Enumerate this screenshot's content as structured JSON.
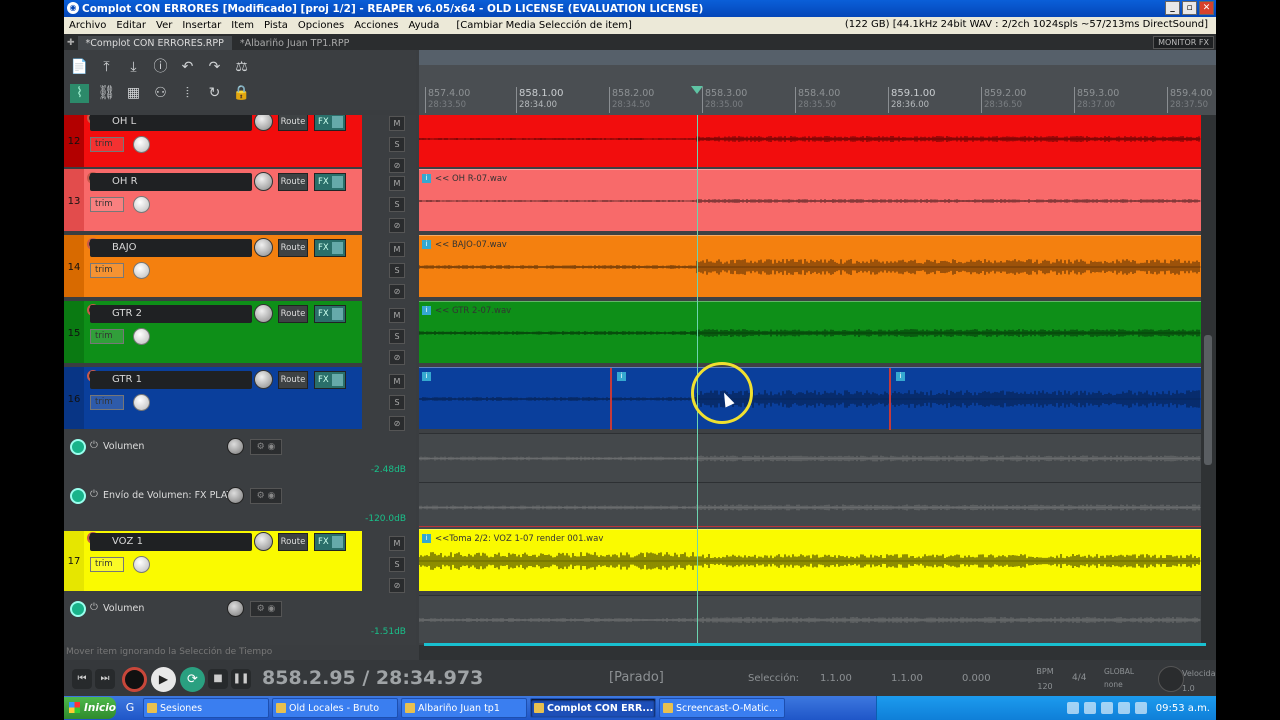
{
  "window": {
    "title": "Complot CON ERRORES [Modificado] [proj 1/2] - REAPER v6.05/x64 - OLD LICENSE (EVALUATION LICENSE)",
    "minimize": "_",
    "maximize": "▫",
    "close": "✕"
  },
  "menu": {
    "items": [
      "Archivo",
      "Editar",
      "Ver",
      "Insertar",
      "Item",
      "Pista",
      "Opciones",
      "Acciones",
      "Ayuda"
    ],
    "extra": "[Cambiar Media Selección de item]",
    "status": "(122 GB) [44.1kHz 24bit WAV : 2/2ch 1024spls ~57/213ms DirectSound]"
  },
  "tabs": {
    "items": [
      "*Complot CON ERRORES.RPP",
      "*Albariño Juan TP1.RPP"
    ],
    "monitor_fx": "MONITOR FX"
  },
  "toolbar": {
    "row1": [
      "📄",
      "⤒",
      "⤓",
      "ⓘ",
      "↶",
      "↷",
      "⚖"
    ],
    "row2": [
      "⌇",
      "⛓",
      "▦",
      "⚇",
      "⦙",
      "↻",
      "🔒"
    ]
  },
  "ruler": {
    "ticks": [
      {
        "bar": "857.4.00",
        "time": "28:33.50",
        "major": false
      },
      {
        "bar": "858.1.00",
        "time": "28:34.00",
        "major": true
      },
      {
        "bar": "858.2.00",
        "time": "28:34.50",
        "major": false
      },
      {
        "bar": "858.3.00",
        "time": "28:35.00",
        "major": false
      },
      {
        "bar": "858.4.00",
        "time": "28:35.50",
        "major": false
      },
      {
        "bar": "859.1.00",
        "time": "28:36.00",
        "major": true
      },
      {
        "bar": "859.2.00",
        "time": "28:36.50",
        "major": false
      },
      {
        "bar": "859.3.00",
        "time": "28:37.00",
        "major": false
      },
      {
        "bar": "859.4.00",
        "time": "28:37.50",
        "major": false
      }
    ]
  },
  "tracks": [
    {
      "num": "12",
      "name": "OH L",
      "color": "#f20d0d",
      "numcolor": "#b30000",
      "route": "Route",
      "fx": "FX",
      "trim": "trim",
      "item": ""
    },
    {
      "num": "13",
      "name": "OH R",
      "color": "#f86a6a",
      "numcolor": "#e24c4c",
      "route": "Route",
      "fx": "FX",
      "trim": "trim",
      "item": "<< OH R-07.wav"
    },
    {
      "num": "14",
      "name": "BAJO",
      "color": "#f4800f",
      "numcolor": "#d86a00",
      "route": "Route",
      "fx": "FX",
      "trim": "trim",
      "item": "<< BAJO-07.wav"
    },
    {
      "num": "15",
      "name": "GTR 2",
      "color": "#0e8f18",
      "numcolor": "#0a7a12",
      "route": "Route",
      "fx": "FX",
      "trim": "trim",
      "item": "<< GTR 2-07.wav"
    },
    {
      "num": "16",
      "name": "GTR 1",
      "color": "#0a3f9c",
      "numcolor": "#083585",
      "route": "Route",
      "fx": "FX",
      "trim": "trim",
      "item": ""
    },
    {
      "num": "17",
      "name": "VOZ 1",
      "color": "#fafa00",
      "numcolor": "#e6e600",
      "route": "Route",
      "fx": "FX",
      "trim": "trim",
      "item": "<<Toma 2/2: VOZ 1-07 render 001.wav"
    }
  ],
  "msbuttons": {
    "mute": "M",
    "solo": "S",
    "phase": "⊘"
  },
  "envelopes": [
    {
      "name": "Volumen",
      "db": "-2.48dB"
    },
    {
      "name": "Envío de Volumen: FX PLATE",
      "db": "-120.0dB"
    },
    {
      "name": "Volumen",
      "db": "-1.51dB"
    }
  ],
  "env_buttons": "⚙ ◉",
  "status_hint": "Mover item ignorando la Selección de Tiempo",
  "transport": {
    "rewind": "⏮",
    "forward": "⏭",
    "stop": "■",
    "pause": "❚❚",
    "play": "▶",
    "loop": "⟳",
    "time": "858.2.95 / 28:34.973",
    "state": "[Parado]",
    "selection_label": "Selección:",
    "sel_start": "1.1.00",
    "sel_end": "1.1.00",
    "sel_len": "0.000",
    "bpm_label": "BPM",
    "bpm": "120",
    "signature": "4/4",
    "global_label": "GLOBAL",
    "global_value": "none",
    "rate_label": "Velocidad",
    "rate": "1.0"
  },
  "taskbar": {
    "start": "Inicio",
    "quick": "G",
    "tasks": [
      "Sesiones",
      "Old Locales - Bruto",
      "Albariño Juan tp1",
      "Complot CON ERR...",
      "Screencast-O-Matic..."
    ],
    "active_task": 3,
    "clock": "09:53 a.m."
  }
}
